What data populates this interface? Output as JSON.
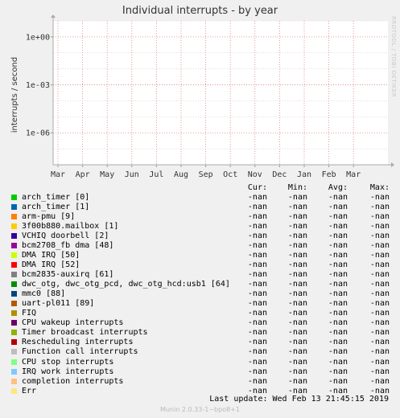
{
  "chart_data": {
    "type": "line",
    "title": "Individual interrupts - by year",
    "ylabel": "interrupts / second",
    "yscale": "log",
    "y_ticks": [
      "1e+00",
      "1e-03",
      "1e-06"
    ],
    "x_ticks": [
      "Mar",
      "Apr",
      "May",
      "Jun",
      "Jul",
      "Aug",
      "Sep",
      "Oct",
      "Nov",
      "Dec",
      "Jan",
      "Feb",
      "Mar"
    ],
    "grid": true,
    "series": [
      {
        "name": "arch_timer [0]",
        "color": "#00cc00",
        "cur": "-nan",
        "min": "-nan",
        "avg": "-nan",
        "max": "-nan"
      },
      {
        "name": "arch_timer [1]",
        "color": "#0066b3",
        "cur": "-nan",
        "min": "-nan",
        "avg": "-nan",
        "max": "-nan"
      },
      {
        "name": "arm-pmu [9]",
        "color": "#ff8000",
        "cur": "-nan",
        "min": "-nan",
        "avg": "-nan",
        "max": "-nan"
      },
      {
        "name": "3f00b880.mailbox [1]",
        "color": "#ffcc00",
        "cur": "-nan",
        "min": "-nan",
        "avg": "-nan",
        "max": "-nan"
      },
      {
        "name": "VCHIQ doorbell [2]",
        "color": "#330099",
        "cur": "-nan",
        "min": "-nan",
        "avg": "-nan",
        "max": "-nan"
      },
      {
        "name": "bcm2708_fb dma [48]",
        "color": "#990099",
        "cur": "-nan",
        "min": "-nan",
        "avg": "-nan",
        "max": "-nan"
      },
      {
        "name": "DMA IRQ [50]",
        "color": "#ccff00",
        "cur": "-nan",
        "min": "-nan",
        "avg": "-nan",
        "max": "-nan"
      },
      {
        "name": "DMA IRQ [52]",
        "color": "#ff0000",
        "cur": "-nan",
        "min": "-nan",
        "avg": "-nan",
        "max": "-nan"
      },
      {
        "name": "bcm2835-auxirq [61]",
        "color": "#808080",
        "cur": "-nan",
        "min": "-nan",
        "avg": "-nan",
        "max": "-nan"
      },
      {
        "name": "dwc_otg, dwc_otg_pcd, dwc_otg_hcd:usb1 [64]",
        "color": "#008f00",
        "cur": "-nan",
        "min": "-nan",
        "avg": "-nan",
        "max": "-nan"
      },
      {
        "name": "mmc0 [88]",
        "color": "#00487d",
        "cur": "-nan",
        "min": "-nan",
        "avg": "-nan",
        "max": "-nan"
      },
      {
        "name": "uart-pl011 [89]",
        "color": "#b35a00",
        "cur": "-nan",
        "min": "-nan",
        "avg": "-nan",
        "max": "-nan"
      },
      {
        "name": "FIQ",
        "color": "#b38f00",
        "cur": "-nan",
        "min": "-nan",
        "avg": "-nan",
        "max": "-nan"
      },
      {
        "name": "CPU wakeup interrupts",
        "color": "#6b006b",
        "cur": "-nan",
        "min": "-nan",
        "avg": "-nan",
        "max": "-nan"
      },
      {
        "name": "Timer broadcast interrupts",
        "color": "#8fb300",
        "cur": "-nan",
        "min": "-nan",
        "avg": "-nan",
        "max": "-nan"
      },
      {
        "name": "Rescheduling interrupts",
        "color": "#b30000",
        "cur": "-nan",
        "min": "-nan",
        "avg": "-nan",
        "max": "-nan"
      },
      {
        "name": "Function call interrupts",
        "color": "#bebebe",
        "cur": "-nan",
        "min": "-nan",
        "avg": "-nan",
        "max": "-nan"
      },
      {
        "name": "CPU stop interrupts",
        "color": "#80ff80",
        "cur": "-nan",
        "min": "-nan",
        "avg": "-nan",
        "max": "-nan"
      },
      {
        "name": "IRQ work interrupts",
        "color": "#80c9ff",
        "cur": "-nan",
        "min": "-nan",
        "avg": "-nan",
        "max": "-nan"
      },
      {
        "name": "completion interrupts",
        "color": "#ffc080",
        "cur": "-nan",
        "min": "-nan",
        "avg": "-nan",
        "max": "-nan"
      },
      {
        "name": "Err",
        "color": "#ffe680",
        "cur": "-nan",
        "min": "-nan",
        "avg": "-nan",
        "max": "-nan"
      }
    ]
  },
  "legend_headers": {
    "cur": "Cur:",
    "min": "Min:",
    "avg": "Avg:",
    "max": "Max:"
  },
  "watermark": "RRDTOOL / TOBI OETIKER",
  "last_update": "Last update:  Wed Feb 13 21:45:15 2019",
  "version": "Munin 2.0.33-1~bpo8+1"
}
